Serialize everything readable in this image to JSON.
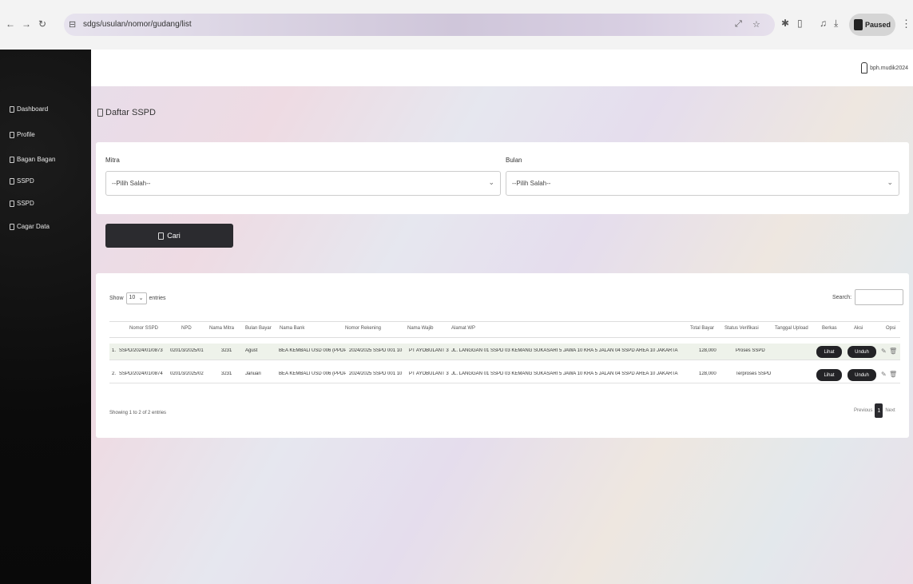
{
  "browser": {
    "url": "sdgs/usulan/nomor/gudang/list",
    "profile_label": "Paused"
  },
  "sidebar": {
    "items": [
      {
        "label": "Dashboard",
        "icon": "home-icon"
      },
      {
        "label": "Profile",
        "icon": "user-icon"
      },
      {
        "label": "Bagan Bagan",
        "icon": "grid-icon"
      },
      {
        "label": "SSPD",
        "icon": "document-icon"
      },
      {
        "label": "SSPD",
        "icon": "document-icon"
      },
      {
        "label": "Cagar Data",
        "icon": "folder-icon"
      }
    ]
  },
  "topbar": {
    "user_name": "bph.mudik2024"
  },
  "page": {
    "title": "Daftar SSPD"
  },
  "filters": {
    "left": {
      "label": "Mitra",
      "placeholder": "--Pilih Salah--"
    },
    "right": {
      "label": "Bulan",
      "placeholder": "--Pilih Salah--"
    },
    "submit_label": "Cari"
  },
  "table": {
    "show_label": "Show",
    "length_value": "10",
    "entries_label": "entries",
    "search_label": "Search:",
    "headers": [
      "Nomor SSPD",
      "NPD",
      "Nama Mitra",
      "Bulan Bayar",
      "Nama Bank",
      "Nomor Rekening",
      "Nama Wajib",
      "Alamat WP",
      "Total Bayar",
      "Status Verifikasi",
      "Tanggal Upload",
      "Berkas",
      "Aksi",
      "Opsi"
    ],
    "rows": [
      {
        "no": "1.",
        "nomor": "SSPD/2024/01/0873",
        "npd": "0201/3/2025/01",
        "mitra": "3231",
        "bulan": "Agust",
        "bank": "BEA KEMBALI USD 006 (PPDP)",
        "rekening": "2024/2025 SSPD 001 10",
        "wajib": "PT AYOBULANT 3",
        "alamat": "JL. LANGGAN 01 SSPD 03 KEMANG SUKASARI 5 JAWA 10 KRA 5 JALAN 04 SSPD AREA 10 JAKARTA",
        "total": "128,000",
        "status": "Proses SSPD",
        "tanggal": "",
        "btn1": "Lihat",
        "btn2": "Unduh"
      },
      {
        "no": "2.",
        "nomor": "SSPD/2024/01/0874",
        "npd": "0201/3/2025/02",
        "mitra": "3231",
        "bulan": "Januari",
        "bank": "BEA KEMBALI USD 006 (PPDP)",
        "rekening": "2024/2025 SSPD 001 10",
        "wajib": "PT AYOBULANT 3",
        "alamat": "JL. LANGGAN 01 SSPD 03 KEMANG SUKASARI 5 JAWA 10 KRA 5 JALAN 04 SSPD AREA 10 JAKARTA",
        "total": "128,000",
        "status": "Terproses SSPD",
        "tanggal": "",
        "btn1": "Lihat",
        "btn2": "Unduh"
      }
    ],
    "info": "Showing 1 to 2 of 2 entries",
    "prev_label": "Previous",
    "current_page": "1",
    "next_label": "Next"
  }
}
